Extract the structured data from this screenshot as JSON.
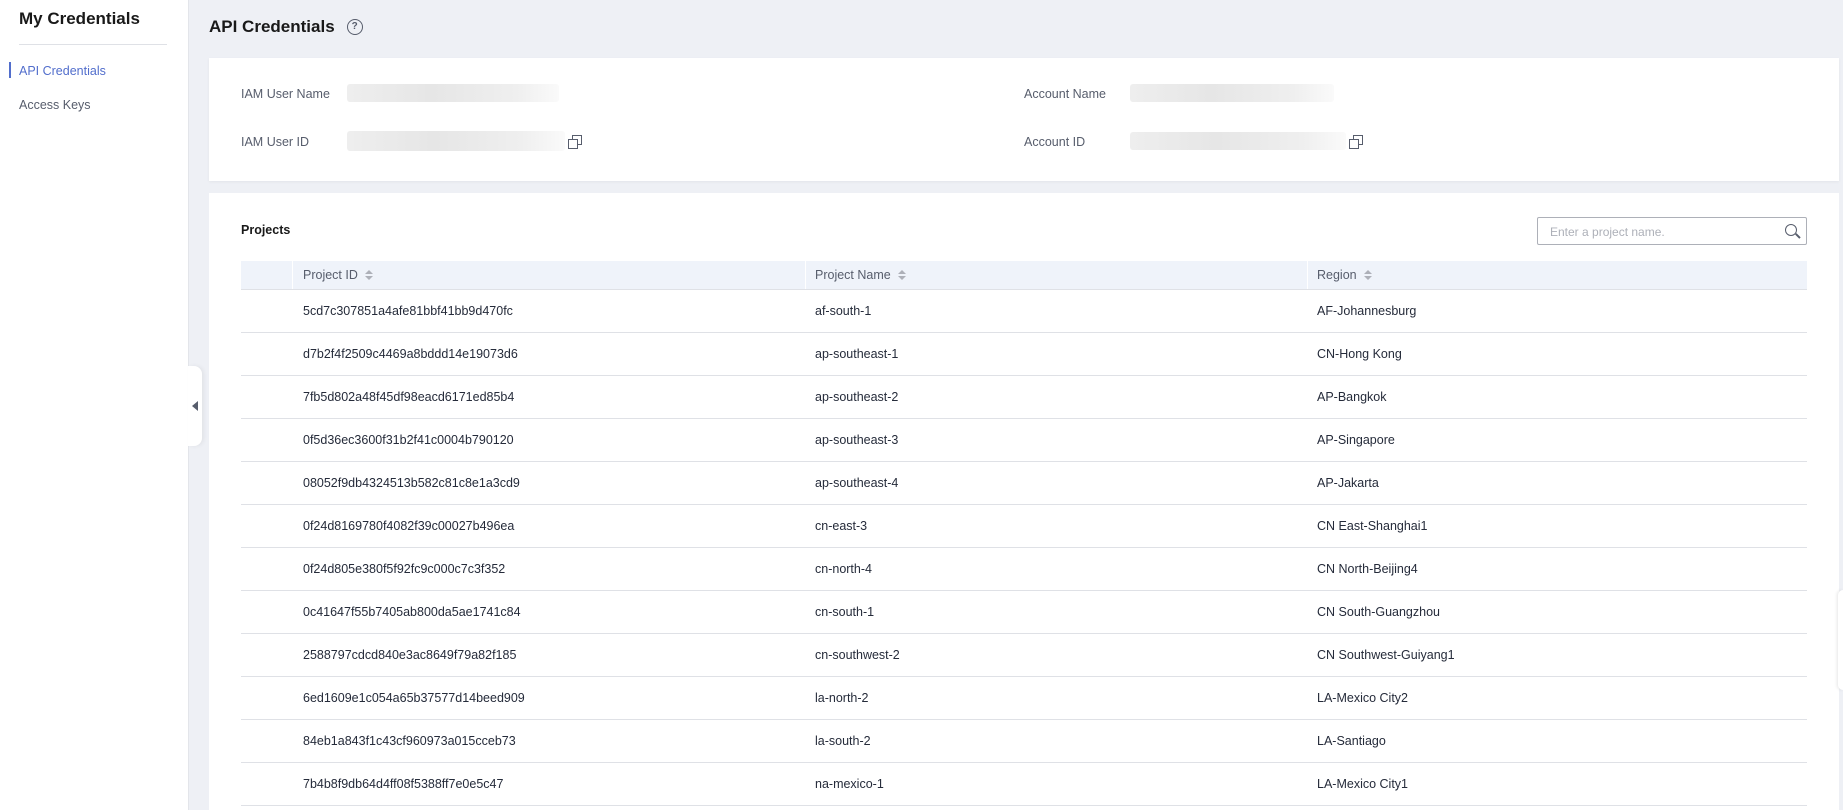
{
  "sidebar": {
    "title": "My Credentials",
    "items": [
      {
        "label": "API Credentials",
        "active": true
      },
      {
        "label": "Access Keys",
        "active": false
      }
    ]
  },
  "header": {
    "title": "API Credentials",
    "help_icon": "?"
  },
  "info": {
    "iam_user_name_label": "IAM User Name",
    "iam_user_id_label": "IAM User ID",
    "account_name_label": "Account Name",
    "account_id_label": "Account ID"
  },
  "projects": {
    "title": "Projects",
    "search_placeholder": "Enter a project name.",
    "columns": [
      "Project ID",
      "Project Name",
      "Region"
    ],
    "rows": [
      [
        "5cd7c307851a4afe81bbf41bb9d470fc",
        "af-south-1",
        "AF-Johannesburg"
      ],
      [
        "d7b2f4f2509c4469a8bddd14e19073d6",
        "ap-southeast-1",
        "CN-Hong Kong"
      ],
      [
        "7fb5d802a48f45df98eacd6171ed85b4",
        "ap-southeast-2",
        "AP-Bangkok"
      ],
      [
        "0f5d36ec3600f31b2f41c0004b790120",
        "ap-southeast-3",
        "AP-Singapore"
      ],
      [
        "08052f9db4324513b582c81c8e1a3cd9",
        "ap-southeast-4",
        "AP-Jakarta"
      ],
      [
        "0f24d8169780f4082f39c00027b496ea",
        "cn-east-3",
        "CN East-Shanghai1"
      ],
      [
        "0f24d805e380f5f92fc9c000c7c3f352",
        "cn-north-4",
        "CN North-Beijing4"
      ],
      [
        "0c41647f55b7405ab800da5ae1741c84",
        "cn-south-1",
        "CN South-Guangzhou"
      ],
      [
        "2588797cdcd840e3ac8649f79a82f185",
        "cn-southwest-2",
        "CN Southwest-Guiyang1"
      ],
      [
        "6ed1609e1c054a65b37577d14beed909",
        "la-north-2",
        "LA-Mexico City2"
      ],
      [
        "84eb1a843f1c43cf960973a015cceb73",
        "la-south-2",
        "LA-Santiago"
      ],
      [
        "7b4b8f9db64d4ff08f5388ff7e0e5c47",
        "na-mexico-1",
        "LA-Mexico City1"
      ]
    ]
  },
  "colors": {
    "accent": "#526ecc",
    "header_bg": "#eff3fa",
    "page_bg": "#eef0f5"
  }
}
